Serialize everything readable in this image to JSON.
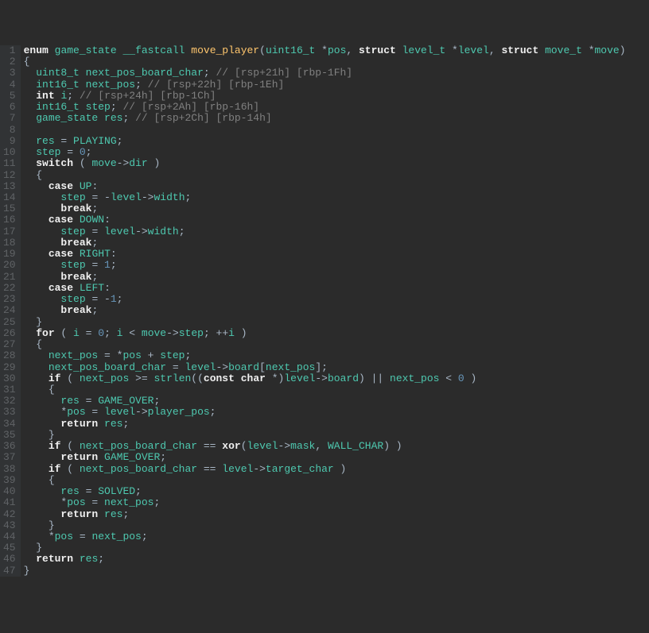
{
  "lines": [
    {
      "num": 1,
      "tokens": [
        {
          "t": "enum",
          "c": "type"
        },
        {
          "t": " "
        },
        {
          "t": "game_state",
          "c": "ty"
        },
        {
          "t": " "
        },
        {
          "t": "__fastcall",
          "c": "ty"
        },
        {
          "t": " "
        },
        {
          "t": "move_player",
          "c": "fn"
        },
        {
          "t": "("
        },
        {
          "t": "uint16_t",
          "c": "ty"
        },
        {
          "t": " *"
        },
        {
          "t": "pos",
          "c": "ty"
        },
        {
          "t": ", "
        },
        {
          "t": "struct",
          "c": "type"
        },
        {
          "t": " "
        },
        {
          "t": "level_t",
          "c": "ty"
        },
        {
          "t": " *"
        },
        {
          "t": "level",
          "c": "ty"
        },
        {
          "t": ", "
        },
        {
          "t": "struct",
          "c": "type"
        },
        {
          "t": " "
        },
        {
          "t": "move_t",
          "c": "ty"
        },
        {
          "t": " *"
        },
        {
          "t": "move",
          "c": "ty"
        },
        {
          "t": ")"
        }
      ]
    },
    {
      "num": 2,
      "tokens": [
        {
          "t": "{"
        }
      ]
    },
    {
      "num": 3,
      "tokens": [
        {
          "t": "  "
        },
        {
          "t": "uint8_t",
          "c": "ty"
        },
        {
          "t": " "
        },
        {
          "t": "next_pos_board_char",
          "c": "ty"
        },
        {
          "t": "; "
        },
        {
          "t": "// [rsp+21h] [rbp-1Fh]",
          "c": "com"
        }
      ]
    },
    {
      "num": 4,
      "tokens": [
        {
          "t": "  "
        },
        {
          "t": "int16_t",
          "c": "ty"
        },
        {
          "t": " "
        },
        {
          "t": "next_pos",
          "c": "ty"
        },
        {
          "t": "; "
        },
        {
          "t": "// [rsp+22h] [rbp-1Eh]",
          "c": "com"
        }
      ]
    },
    {
      "num": 5,
      "tokens": [
        {
          "t": "  "
        },
        {
          "t": "int",
          "c": "kw"
        },
        {
          "t": " "
        },
        {
          "t": "i",
          "c": "ty"
        },
        {
          "t": "; "
        },
        {
          "t": "// [rsp+24h] [rbp-1Ch]",
          "c": "com"
        }
      ]
    },
    {
      "num": 6,
      "tokens": [
        {
          "t": "  "
        },
        {
          "t": "int16_t",
          "c": "ty"
        },
        {
          "t": " "
        },
        {
          "t": "step",
          "c": "ty"
        },
        {
          "t": "; "
        },
        {
          "t": "// [rsp+2Ah] [rbp-16h]",
          "c": "com"
        }
      ]
    },
    {
      "num": 7,
      "tokens": [
        {
          "t": "  "
        },
        {
          "t": "game_state",
          "c": "ty"
        },
        {
          "t": " "
        },
        {
          "t": "res",
          "c": "ty"
        },
        {
          "t": "; "
        },
        {
          "t": "// [rsp+2Ch] [rbp-14h]",
          "c": "com"
        }
      ]
    },
    {
      "num": 8,
      "tokens": [
        {
          "t": ""
        }
      ]
    },
    {
      "num": 9,
      "tokens": [
        {
          "t": "  "
        },
        {
          "t": "res",
          "c": "ty"
        },
        {
          "t": " = "
        },
        {
          "t": "PLAYING",
          "c": "ty"
        },
        {
          "t": ";"
        }
      ]
    },
    {
      "num": 10,
      "tokens": [
        {
          "t": "  "
        },
        {
          "t": "step",
          "c": "ty"
        },
        {
          "t": " = "
        },
        {
          "t": "0",
          "c": "num"
        },
        {
          "t": ";"
        }
      ]
    },
    {
      "num": 11,
      "tokens": [
        {
          "t": "  "
        },
        {
          "t": "switch",
          "c": "kw"
        },
        {
          "t": " ( "
        },
        {
          "t": "move",
          "c": "ty"
        },
        {
          "t": "->"
        },
        {
          "t": "dir",
          "c": "ty"
        },
        {
          "t": " )"
        }
      ]
    },
    {
      "num": 12,
      "tokens": [
        {
          "t": "  {"
        }
      ]
    },
    {
      "num": 13,
      "tokens": [
        {
          "t": "    "
        },
        {
          "t": "case",
          "c": "kw"
        },
        {
          "t": " "
        },
        {
          "t": "UP",
          "c": "ty"
        },
        {
          "t": ":"
        }
      ]
    },
    {
      "num": 14,
      "tokens": [
        {
          "t": "      "
        },
        {
          "t": "step",
          "c": "ty"
        },
        {
          "t": " = -"
        },
        {
          "t": "level",
          "c": "ty"
        },
        {
          "t": "->"
        },
        {
          "t": "width",
          "c": "ty"
        },
        {
          "t": ";"
        }
      ]
    },
    {
      "num": 15,
      "tokens": [
        {
          "t": "      "
        },
        {
          "t": "break",
          "c": "kw"
        },
        {
          "t": ";"
        }
      ]
    },
    {
      "num": 16,
      "tokens": [
        {
          "t": "    "
        },
        {
          "t": "case",
          "c": "kw"
        },
        {
          "t": " "
        },
        {
          "t": "DOWN",
          "c": "ty"
        },
        {
          "t": ":"
        }
      ]
    },
    {
      "num": 17,
      "tokens": [
        {
          "t": "      "
        },
        {
          "t": "step",
          "c": "ty"
        },
        {
          "t": " = "
        },
        {
          "t": "level",
          "c": "ty"
        },
        {
          "t": "->"
        },
        {
          "t": "width",
          "c": "ty"
        },
        {
          "t": ";"
        }
      ]
    },
    {
      "num": 18,
      "tokens": [
        {
          "t": "      "
        },
        {
          "t": "break",
          "c": "kw"
        },
        {
          "t": ";"
        }
      ]
    },
    {
      "num": 19,
      "tokens": [
        {
          "t": "    "
        },
        {
          "t": "case",
          "c": "kw"
        },
        {
          "t": " "
        },
        {
          "t": "RIGHT",
          "c": "ty"
        },
        {
          "t": ":"
        }
      ]
    },
    {
      "num": 20,
      "tokens": [
        {
          "t": "      "
        },
        {
          "t": "step",
          "c": "ty"
        },
        {
          "t": " = "
        },
        {
          "t": "1",
          "c": "num"
        },
        {
          "t": ";"
        }
      ]
    },
    {
      "num": 21,
      "tokens": [
        {
          "t": "      "
        },
        {
          "t": "break",
          "c": "kw"
        },
        {
          "t": ";"
        }
      ]
    },
    {
      "num": 22,
      "tokens": [
        {
          "t": "    "
        },
        {
          "t": "case",
          "c": "kw"
        },
        {
          "t": " "
        },
        {
          "t": "LEFT",
          "c": "ty"
        },
        {
          "t": ":"
        }
      ]
    },
    {
      "num": 23,
      "tokens": [
        {
          "t": "      "
        },
        {
          "t": "step",
          "c": "ty"
        },
        {
          "t": " = -"
        },
        {
          "t": "1",
          "c": "num"
        },
        {
          "t": ";"
        }
      ]
    },
    {
      "num": 24,
      "tokens": [
        {
          "t": "      "
        },
        {
          "t": "break",
          "c": "kw"
        },
        {
          "t": ";"
        }
      ]
    },
    {
      "num": 25,
      "tokens": [
        {
          "t": "  }"
        }
      ]
    },
    {
      "num": 26,
      "tokens": [
        {
          "t": "  "
        },
        {
          "t": "for",
          "c": "kw"
        },
        {
          "t": " ( "
        },
        {
          "t": "i",
          "c": "ty"
        },
        {
          "t": " = "
        },
        {
          "t": "0",
          "c": "num"
        },
        {
          "t": "; "
        },
        {
          "t": "i",
          "c": "ty"
        },
        {
          "t": " < "
        },
        {
          "t": "move",
          "c": "ty"
        },
        {
          "t": "->"
        },
        {
          "t": "step",
          "c": "ty"
        },
        {
          "t": "; ++"
        },
        {
          "t": "i",
          "c": "ty"
        },
        {
          "t": " )"
        }
      ]
    },
    {
      "num": 27,
      "tokens": [
        {
          "t": "  {"
        }
      ]
    },
    {
      "num": 28,
      "tokens": [
        {
          "t": "    "
        },
        {
          "t": "next_pos",
          "c": "ty"
        },
        {
          "t": " = *"
        },
        {
          "t": "pos",
          "c": "ty"
        },
        {
          "t": " + "
        },
        {
          "t": "step",
          "c": "ty"
        },
        {
          "t": ";"
        }
      ]
    },
    {
      "num": 29,
      "tokens": [
        {
          "t": "    "
        },
        {
          "t": "next_pos_board_char",
          "c": "ty"
        },
        {
          "t": " = "
        },
        {
          "t": "level",
          "c": "ty"
        },
        {
          "t": "->"
        },
        {
          "t": "board",
          "c": "ty"
        },
        {
          "t": "["
        },
        {
          "t": "next_pos",
          "c": "ty"
        },
        {
          "t": "];"
        }
      ]
    },
    {
      "num": 30,
      "tokens": [
        {
          "t": "    "
        },
        {
          "t": "if",
          "c": "kw"
        },
        {
          "t": " ( "
        },
        {
          "t": "next_pos",
          "c": "ty"
        },
        {
          "t": " >= "
        },
        {
          "t": "strlen",
          "c": "ty"
        },
        {
          "t": "(("
        },
        {
          "t": "const",
          "c": "kw"
        },
        {
          "t": " "
        },
        {
          "t": "char",
          "c": "kw"
        },
        {
          "t": " *)"
        },
        {
          "t": "level",
          "c": "ty"
        },
        {
          "t": "->"
        },
        {
          "t": "board",
          "c": "ty"
        },
        {
          "t": ") || "
        },
        {
          "t": "next_pos",
          "c": "ty"
        },
        {
          "t": " < "
        },
        {
          "t": "0",
          "c": "num"
        },
        {
          "t": " )"
        }
      ]
    },
    {
      "num": 31,
      "tokens": [
        {
          "t": "    {"
        }
      ]
    },
    {
      "num": 32,
      "tokens": [
        {
          "t": "      "
        },
        {
          "t": "res",
          "c": "ty"
        },
        {
          "t": " = "
        },
        {
          "t": "GAME_OVER",
          "c": "ty"
        },
        {
          "t": ";"
        }
      ]
    },
    {
      "num": 33,
      "tokens": [
        {
          "t": "      *"
        },
        {
          "t": "pos",
          "c": "ty"
        },
        {
          "t": " = "
        },
        {
          "t": "level",
          "c": "ty"
        },
        {
          "t": "->"
        },
        {
          "t": "player_pos",
          "c": "ty"
        },
        {
          "t": ";"
        }
      ]
    },
    {
      "num": 34,
      "tokens": [
        {
          "t": "      "
        },
        {
          "t": "return",
          "c": "kw"
        },
        {
          "t": " "
        },
        {
          "t": "res",
          "c": "ty"
        },
        {
          "t": ";"
        }
      ]
    },
    {
      "num": 35,
      "tokens": [
        {
          "t": "    }"
        }
      ]
    },
    {
      "num": 36,
      "tokens": [
        {
          "t": "    "
        },
        {
          "t": "if",
          "c": "kw"
        },
        {
          "t": " ( "
        },
        {
          "t": "next_pos_board_char",
          "c": "ty"
        },
        {
          "t": " == "
        },
        {
          "t": "xor",
          "c": "kw"
        },
        {
          "t": "("
        },
        {
          "t": "level",
          "c": "ty"
        },
        {
          "t": "->"
        },
        {
          "t": "mask",
          "c": "ty"
        },
        {
          "t": ", "
        },
        {
          "t": "WALL_CHAR",
          "c": "ty"
        },
        {
          "t": ") )"
        }
      ]
    },
    {
      "num": 37,
      "tokens": [
        {
          "t": "      "
        },
        {
          "t": "return",
          "c": "kw"
        },
        {
          "t": " "
        },
        {
          "t": "GAME_OVER",
          "c": "ty"
        },
        {
          "t": ";"
        }
      ]
    },
    {
      "num": 38,
      "tokens": [
        {
          "t": "    "
        },
        {
          "t": "if",
          "c": "kw"
        },
        {
          "t": " ( "
        },
        {
          "t": "next_pos_board_char",
          "c": "ty"
        },
        {
          "t": " == "
        },
        {
          "t": "level",
          "c": "ty"
        },
        {
          "t": "->"
        },
        {
          "t": "target_char",
          "c": "ty"
        },
        {
          "t": " )"
        }
      ]
    },
    {
      "num": 39,
      "tokens": [
        {
          "t": "    {"
        }
      ]
    },
    {
      "num": 40,
      "tokens": [
        {
          "t": "      "
        },
        {
          "t": "res",
          "c": "ty"
        },
        {
          "t": " = "
        },
        {
          "t": "SOLVED",
          "c": "ty"
        },
        {
          "t": ";"
        }
      ]
    },
    {
      "num": 41,
      "tokens": [
        {
          "t": "      *"
        },
        {
          "t": "pos",
          "c": "ty"
        },
        {
          "t": " = "
        },
        {
          "t": "next_pos",
          "c": "ty"
        },
        {
          "t": ";"
        }
      ]
    },
    {
      "num": 42,
      "tokens": [
        {
          "t": "      "
        },
        {
          "t": "return",
          "c": "kw"
        },
        {
          "t": " "
        },
        {
          "t": "res",
          "c": "ty"
        },
        {
          "t": ";"
        }
      ]
    },
    {
      "num": 43,
      "tokens": [
        {
          "t": "    }"
        }
      ]
    },
    {
      "num": 44,
      "tokens": [
        {
          "t": "    *"
        },
        {
          "t": "pos",
          "c": "ty"
        },
        {
          "t": " = "
        },
        {
          "t": "next_pos",
          "c": "ty"
        },
        {
          "t": ";"
        }
      ]
    },
    {
      "num": 45,
      "tokens": [
        {
          "t": "  }"
        }
      ]
    },
    {
      "num": 46,
      "tokens": [
        {
          "t": "  "
        },
        {
          "t": "return",
          "c": "kw"
        },
        {
          "t": " "
        },
        {
          "t": "res",
          "c": "ty"
        },
        {
          "t": ";"
        }
      ]
    },
    {
      "num": 47,
      "tokens": [
        {
          "t": "}"
        }
      ]
    }
  ]
}
